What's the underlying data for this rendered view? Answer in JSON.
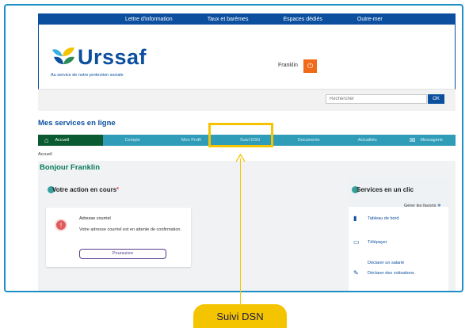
{
  "topnav": [
    "Lettre d'information",
    "Taux et barèmes",
    "Espaces dédiés",
    "Outre-mer"
  ],
  "logo": {
    "name": "Urssaf",
    "tagline": "Au service de notre protection sociale"
  },
  "user": {
    "name": "Franklin"
  },
  "search": {
    "placeholder": "Rechercher",
    "ok_label": "OK"
  },
  "services_title": "Mes services en ligne",
  "nav": [
    {
      "label": "Accueil",
      "icon": "home-icon"
    },
    {
      "label": "Compte"
    },
    {
      "label": "Mon Profil"
    },
    {
      "label": "Suivi DSN"
    },
    {
      "label": "Documents"
    },
    {
      "label": "Actualités"
    },
    {
      "label": "Messagerie",
      "icon": "envelope-icon"
    }
  ],
  "breadcrumb": "Accueil",
  "greeting": "Bonjour Franklin",
  "action": {
    "title": "Votre action en cours",
    "required_mark": "*",
    "notif_title": "Adresse courriel",
    "notif_text": "Votre adresse courriel est en attente de confirmation.",
    "button": "Poursuivre"
  },
  "clic": {
    "title": "Services en un clic",
    "favorites": "Gérer les favoris",
    "items": [
      {
        "label": "Tableau de bord",
        "icon": "document-icon"
      },
      {
        "label": "Télépayer",
        "icon": "card-icon"
      },
      {
        "label": "Déclarer un salarié",
        "icon": ""
      },
      {
        "label": "Déclarer des cotisations",
        "icon": "pen-icon"
      }
    ]
  },
  "callout": {
    "label": "Suivi DSN"
  },
  "colors": {
    "brand": "#0b4f9e",
    "nav": "#2f9cb8",
    "nav_active": "#0a5b31",
    "highlight": "#f5c400",
    "accent": "#f06a1a",
    "frame": "#1c8fc7"
  }
}
